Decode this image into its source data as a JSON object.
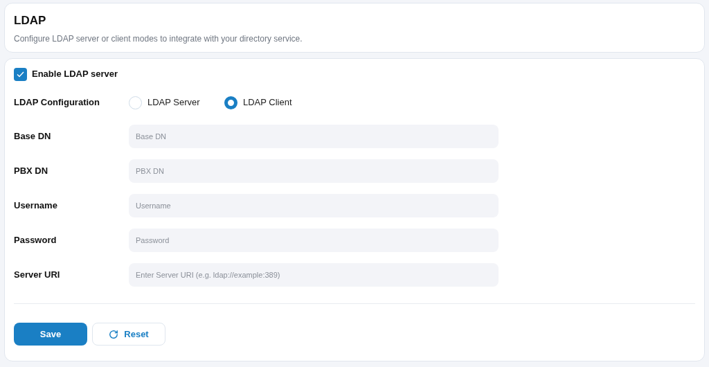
{
  "header": {
    "title": "LDAP",
    "description": "Configure LDAP server or client modes to integrate with your directory service."
  },
  "enable": {
    "label": "Enable LDAP server",
    "checked": true
  },
  "configuration": {
    "label": "LDAP Configuration",
    "options": [
      {
        "label": "LDAP Server",
        "selected": false
      },
      {
        "label": "LDAP Client",
        "selected": true
      }
    ]
  },
  "fields": [
    {
      "label": "Base DN",
      "placeholder": "Base DN"
    },
    {
      "label": "PBX DN",
      "placeholder": "PBX DN"
    },
    {
      "label": "Username",
      "placeholder": "Username"
    },
    {
      "label": "Password",
      "placeholder": "Password"
    },
    {
      "label": "Server URI",
      "placeholder": "Enter Server URI (e.g. ldap://example:389)"
    }
  ],
  "buttons": [
    {
      "kind": "primary",
      "label": "Save"
    },
    {
      "kind": "reset",
      "label": "Reset"
    }
  ]
}
